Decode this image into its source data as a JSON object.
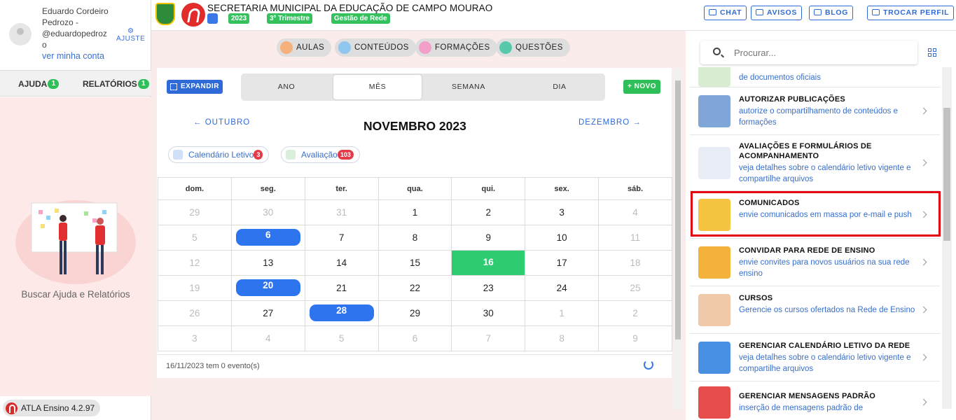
{
  "user": {
    "name_lines": [
      "Eduardo Cordeiro",
      "Pedrozo -",
      "@eduardopedroz",
      "o"
    ],
    "adjust_label": "AJUSTE",
    "account_link": "ver minha conta"
  },
  "left_tabs": {
    "help_label": "AJUDA",
    "help_count": "1",
    "reports_label": "RELATÓRIOS",
    "reports_count": "1"
  },
  "left_body": {
    "caption": "Buscar Ajuda e Relatórios"
  },
  "version": "ATLA Ensino 4.2.97",
  "header": {
    "org_title": "SECRETARIA MUNICIPAL DA EDUCAÇÃO DE CAMPO MOURAO",
    "chips": [
      "2023",
      "3º Trimestre",
      "Gestão de Rede"
    ],
    "buttons": [
      "CHAT",
      "AVISOS",
      "BLOG",
      "TROCAR PERFIL"
    ]
  },
  "modules": [
    "AULAS",
    "CONTEÚDOS",
    "FORMAÇÕES",
    "QUESTÕES"
  ],
  "calendar": {
    "expand_label": "EXPANDIR",
    "views": [
      "ANO",
      "MÊS",
      "SEMANA",
      "DIA"
    ],
    "active_view": "MÊS",
    "new_label": "+ NOVO",
    "prev_month": "← OUTUBRO",
    "next_month": "DEZEMBRO →",
    "month_title": "NOVEMBRO 2023",
    "filters": [
      {
        "label": "Calendário Letivo",
        "count": "3"
      },
      {
        "label": "Avaliação",
        "count": "103"
      }
    ],
    "weekdays": [
      "dom.",
      "seg.",
      "ter.",
      "qua.",
      "qui.",
      "sex.",
      "sáb."
    ],
    "weeks": [
      [
        "29",
        "30",
        "31",
        "1",
        "2",
        "3",
        "4"
      ],
      [
        "5",
        "6",
        "7",
        "8",
        "9",
        "10",
        "11"
      ],
      [
        "12",
        "13",
        "14",
        "15",
        "16",
        "17",
        "18"
      ],
      [
        "19",
        "20",
        "21",
        "22",
        "23",
        "24",
        "25"
      ],
      [
        "26",
        "27",
        "28",
        "29",
        "30",
        "1",
        "2"
      ],
      [
        "3",
        "4",
        "5",
        "6",
        "7",
        "8",
        "9"
      ]
    ],
    "selected_day": "16",
    "event_days": [
      "6",
      "20",
      "28"
    ],
    "footer": "16/11/2023 tem 0 evento(s)"
  },
  "right_panel": {
    "search_placeholder": "Procurar...",
    "items": [
      {
        "title": "",
        "desc": "de documentos oficiais",
        "icon": "documents-icon"
      },
      {
        "title": "AUTORIZAR PUBLICAÇÕES",
        "desc": "autorize o compartilhamento de conteúdos e formações",
        "icon": "books-icon"
      },
      {
        "title": "AVALIAÇÕES E FORMULÁRIOS DE ACOMPANHAMENTO",
        "desc": "veja detalhes sobre o calendário letivo vigente e compartilhe arquivos",
        "icon": "grade-form-icon"
      },
      {
        "title": "COMUNICADOS",
        "desc": "envie comunicados em massa por e-mail e push",
        "icon": "envelope-icon"
      },
      {
        "title": "CONVIDAR PARA REDE DE ENSINO",
        "desc": "envie convites para novos usuários na sua rede ensino",
        "icon": "medal-icon"
      },
      {
        "title": "CURSOS",
        "desc": "Gerencie os cursos ofertados na Rede de Ensino",
        "icon": "people-icon"
      },
      {
        "title": "GERENCIAR CALENDÁRIO LETIVO DA REDE",
        "desc": "veja detalhes sobre o calendário letivo vigente e compartilhe arquivos",
        "icon": "calendar-icon"
      },
      {
        "title": "GERENCIAR MENSAGENS PADRÃO",
        "desc": "inserção de mensagens padrão de",
        "icon": "message-template-icon"
      }
    ]
  },
  "colors": {
    "accent": "#2f6bd8",
    "green": "#2fbf59",
    "highlight": "#e3000f",
    "event": "#2f74ef"
  }
}
